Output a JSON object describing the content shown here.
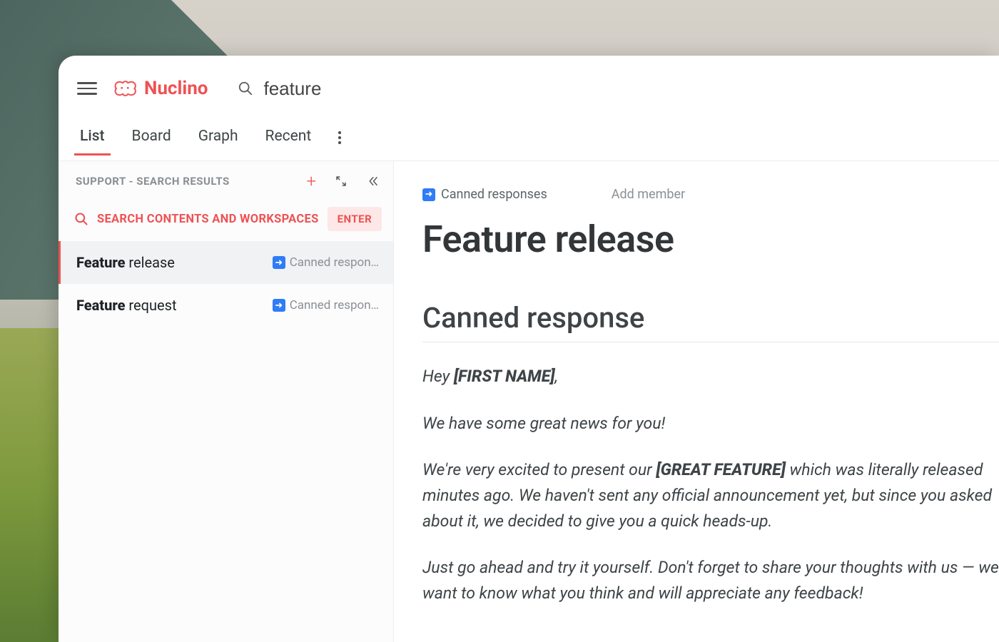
{
  "brand": {
    "name": "Nuclino"
  },
  "search": {
    "value": "feature"
  },
  "tabs": [
    "List",
    "Board",
    "Graph",
    "Recent"
  ],
  "active_tab": 0,
  "sidebar": {
    "header": "SUPPORT - SEARCH RESULTS",
    "search_action_label": "SEARCH CONTENTS AND WORKSPACES",
    "enter_badge": "ENTER",
    "results": [
      {
        "title_bold": "Feature",
        "title_rest": " release",
        "meta": "Canned respon…"
      },
      {
        "title_bold": "Feature",
        "title_rest": " request",
        "meta": "Canned respon…"
      }
    ],
    "active_result": 0
  },
  "content": {
    "breadcrumb": "Canned responses",
    "add_member": "Add member",
    "title": "Feature release",
    "section": "Canned response",
    "paragraphs": [
      {
        "pre": "Hey ",
        "bold": "[FIRST NAME]",
        "post": ","
      },
      {
        "pre": "We have some great news for you!",
        "bold": "",
        "post": ""
      },
      {
        "pre": "We're very excited to present our ",
        "bold": "[GREAT FEATURE]",
        "post": " which was literally released minutes ago. We haven't sent any official announcement yet, but since you asked about it, we decided to give you a quick heads-up."
      },
      {
        "pre": "Just go ahead and try it yourself. Don't forget to share your thoughts with us — we want to know what you think and will appreciate any feedback!",
        "bold": "",
        "post": ""
      }
    ]
  }
}
